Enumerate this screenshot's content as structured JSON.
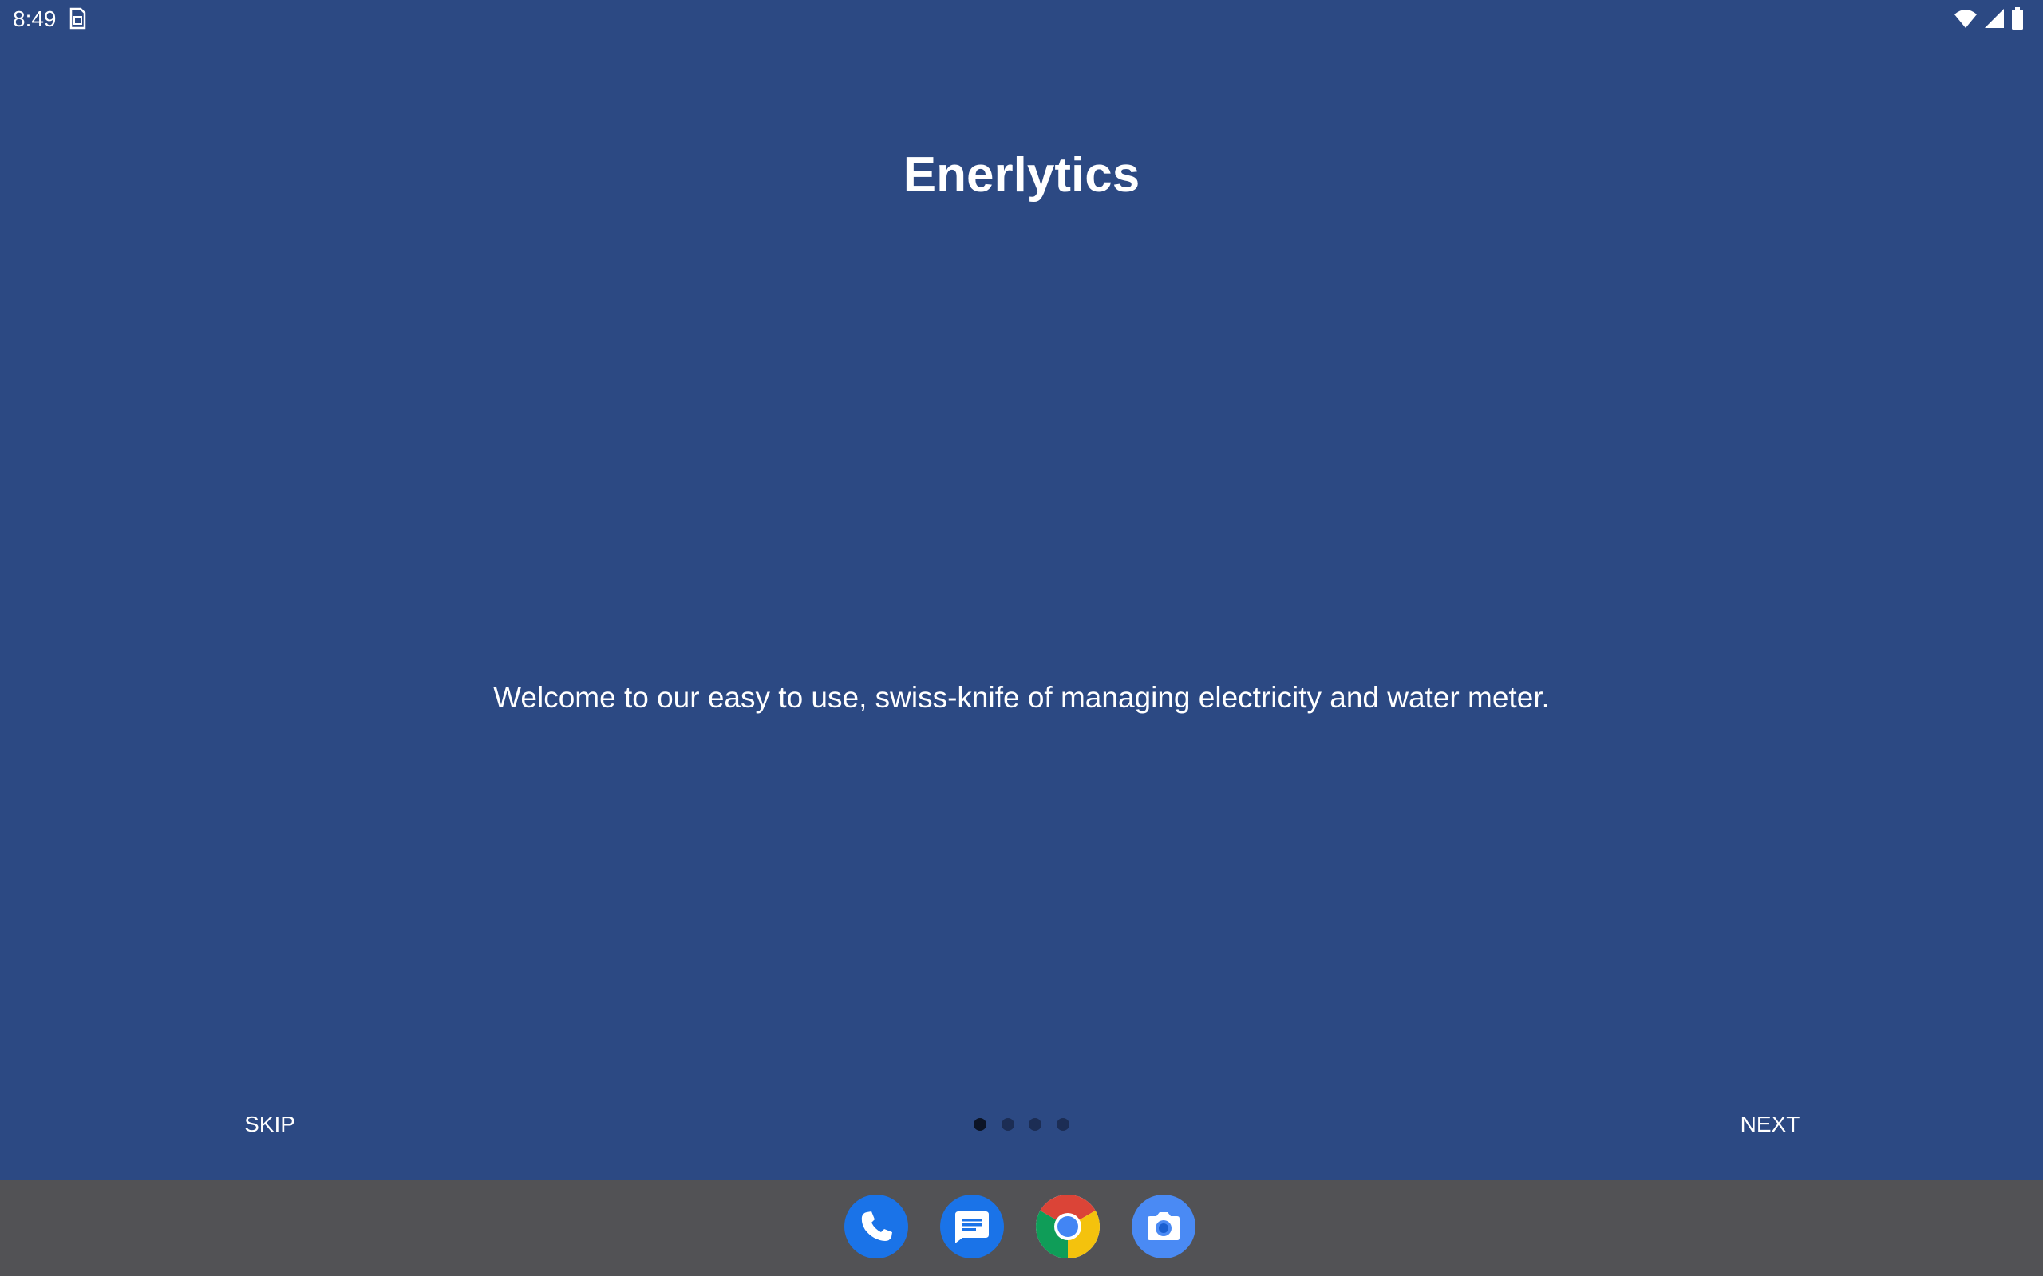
{
  "status_bar": {
    "time": "8:49",
    "notification_icon": "sim-card-icon",
    "wifi_icon": "wifi-icon",
    "signal_icon": "signal-icon",
    "battery_icon": "battery-icon"
  },
  "onboarding": {
    "title": "Enerlytics",
    "description": "Welcome to our easy to use, swiss-knife of managing electricity and water meter.",
    "skip_label": "SKIP",
    "next_label": "NEXT",
    "page_count": 4,
    "current_page": 1
  },
  "dock": {
    "apps": [
      {
        "name": "phone-app-icon",
        "color": "#1a73e8"
      },
      {
        "name": "messages-app-icon",
        "color": "#1a73e8"
      },
      {
        "name": "chrome-app-icon",
        "color": "#4285f4"
      },
      {
        "name": "camera-app-icon",
        "color": "#4a8af4"
      }
    ]
  },
  "colors": {
    "background": "#2c4983",
    "dock": "#525255",
    "text": "#ffffff"
  }
}
